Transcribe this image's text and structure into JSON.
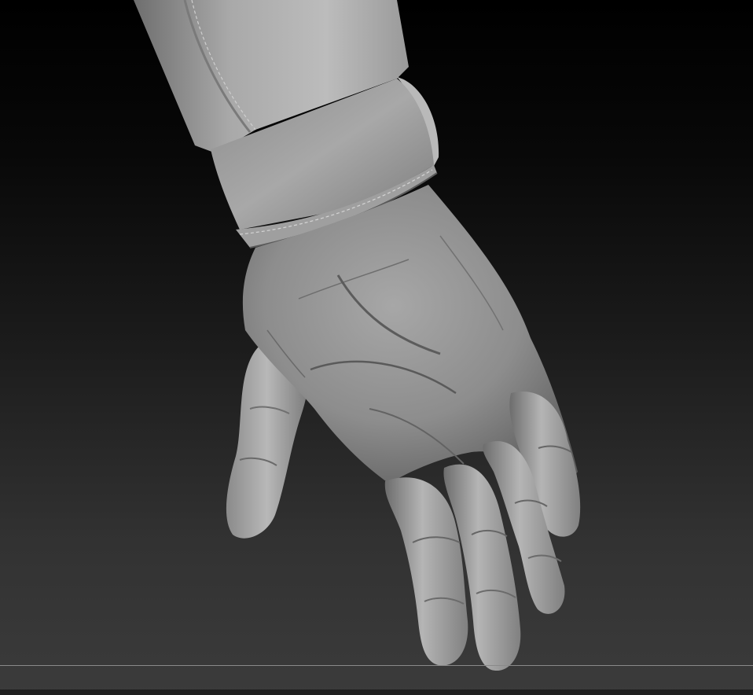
{
  "viewport": {
    "model": "hand-sculpt",
    "icons": [
      "sleeve",
      "cuff",
      "hand"
    ]
  },
  "colors": {
    "background_top": "#000000",
    "background_bottom": "#3b3b3b",
    "clay_light": "#bdbdbd",
    "clay_mid": "#8f8f8f",
    "clay_dark": "#4a4a4a",
    "floor_line": "#8a8a8a"
  }
}
